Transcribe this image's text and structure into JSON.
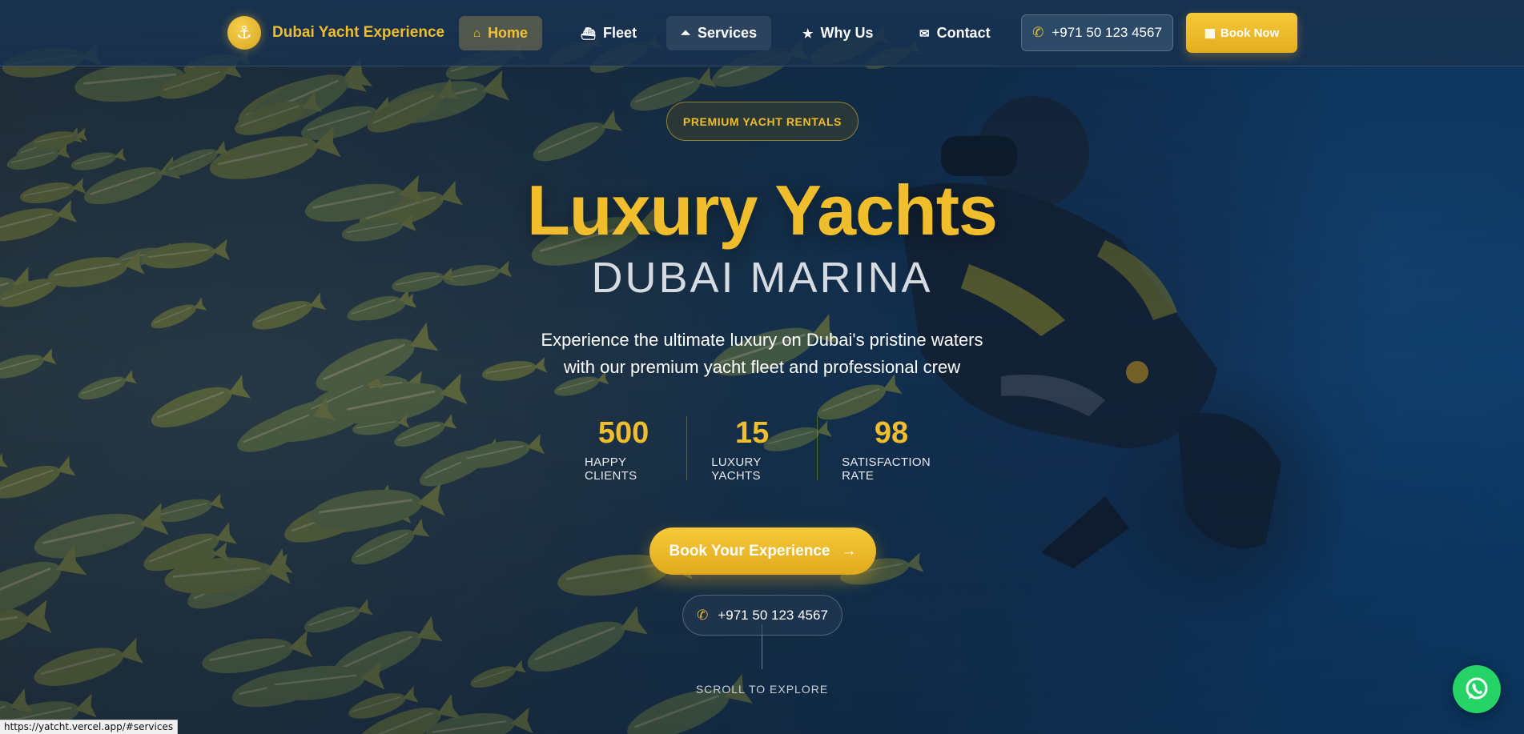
{
  "nav": {
    "brand": "Dubai Yacht Experience",
    "items": [
      {
        "label": "Home",
        "icon": "home-icon",
        "glyph": "⌂"
      },
      {
        "label": "Fleet",
        "icon": "ship-icon",
        "glyph": "⛴"
      },
      {
        "label": "Services",
        "icon": "concierge-bell-icon",
        "glyph": "⏶"
      },
      {
        "label": "Why Us",
        "icon": "star-icon",
        "glyph": "★"
      },
      {
        "label": "Contact",
        "icon": "envelope-icon",
        "glyph": "✉"
      }
    ],
    "phone": "+971 50 123 4567",
    "book_now": "Book Now"
  },
  "hero": {
    "badge": "PREMIUM YACHT RENTALS",
    "title": "Luxury Yachts",
    "subtitle": "DUBAI MARINA",
    "description_line1": "Experience the ultimate luxury on Dubai's pristine waters",
    "description_line2": "with our premium yacht fleet and professional crew",
    "stats": [
      {
        "value": "500",
        "label": "HAPPY CLIENTS"
      },
      {
        "value": "15",
        "label": "LUXURY YACHTS"
      },
      {
        "value": "98",
        "label": "SATISFACTION RATE"
      }
    ],
    "cta_label": "Book Your Experience",
    "cta_phone": "+971 50 123 4567",
    "scroll_text": "SCROLL TO EXPLORE"
  },
  "status_url": "https://yatcht.vercel.app/#services",
  "colors": {
    "accent": "#f0bd2c",
    "nav_bg": "#18324f",
    "whatsapp": "#25d366"
  }
}
